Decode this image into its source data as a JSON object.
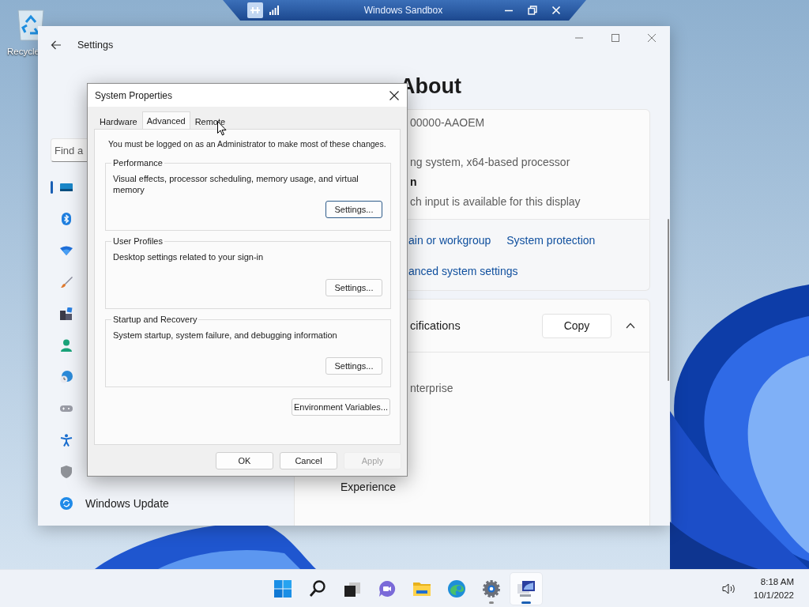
{
  "desktop": {
    "icons": [
      {
        "label": "Recycle"
      }
    ]
  },
  "sandbox_bar": {
    "title": "Windows Sandbox"
  },
  "settings": {
    "title": "Settings",
    "search": {
      "placeholder": "Find a"
    },
    "nav": [
      {
        "kind": "system",
        "selected": true
      },
      {
        "kind": "bluetooth",
        "selected": false
      },
      {
        "kind": "network",
        "selected": false
      },
      {
        "kind": "personalization",
        "selected": false
      },
      {
        "kind": "apps",
        "selected": false
      },
      {
        "kind": "accounts",
        "selected": false
      },
      {
        "kind": "time",
        "selected": false
      },
      {
        "kind": "gaming",
        "selected": false
      },
      {
        "kind": "accessibility",
        "selected": false
      },
      {
        "kind": "privacy",
        "selected": false
      },
      {
        "kind": "update",
        "label": "Windows Update",
        "selected": false
      }
    ],
    "heading": "About",
    "device_specs": [
      {
        "kind": "value",
        "text": "00000-AAOEM"
      },
      {
        "kind": "value",
        "text": "ng system, x64-based processor"
      },
      {
        "kind": "label",
        "text": "n"
      },
      {
        "kind": "value",
        "text": "ch input is available for this display"
      }
    ],
    "related_links": [
      {
        "links": [
          "ain or workgroup",
          "System protection"
        ]
      },
      {
        "links": [
          "anced system settings"
        ]
      }
    ],
    "windows_specs": {
      "title": "cifications",
      "copy_button": "Copy",
      "expanded": true,
      "lines": [
        {
          "kind": "value",
          "text": "nterprise"
        },
        {
          "kind": "label",
          "text": "Experience"
        }
      ]
    }
  },
  "dialog": {
    "title": "System Properties",
    "tabs": [
      {
        "label": "Hardware",
        "selected": false
      },
      {
        "label": "Advanced",
        "selected": true
      },
      {
        "label": "Remote",
        "selected": false
      }
    ],
    "notice": "You must be logged on as an Administrator to make most of these changes.",
    "groups": [
      {
        "title": "Performance",
        "description": "Visual effects, processor scheduling, memory usage, and virtual memory",
        "button": "Settings...",
        "focused": true
      },
      {
        "title": "User Profiles",
        "description": "Desktop settings related to your sign-in",
        "button": "Settings...",
        "focused": false
      },
      {
        "title": "Startup and Recovery",
        "description": "System startup, system failure, and debugging information",
        "button": "Settings...",
        "focused": false
      }
    ],
    "env_button": "Environment Variables...",
    "buttons": [
      {
        "label": "OK",
        "disabled": false
      },
      {
        "label": "Cancel",
        "disabled": false
      },
      {
        "label": "Apply",
        "disabled": true
      }
    ]
  },
  "taskbar": {
    "apps": [
      {
        "kind": "start",
        "open": false,
        "active": false
      },
      {
        "kind": "search",
        "open": false,
        "active": false
      },
      {
        "kind": "taskview",
        "open": false,
        "active": false
      },
      {
        "kind": "chat",
        "open": false,
        "active": false
      },
      {
        "kind": "explorer",
        "open": false,
        "active": false
      },
      {
        "kind": "edge",
        "open": false,
        "active": false
      },
      {
        "kind": "settings",
        "open": true,
        "active": false
      },
      {
        "kind": "sandbox",
        "open": true,
        "active": true
      }
    ],
    "time": "8:18 AM",
    "date": "10/1/2022"
  }
}
